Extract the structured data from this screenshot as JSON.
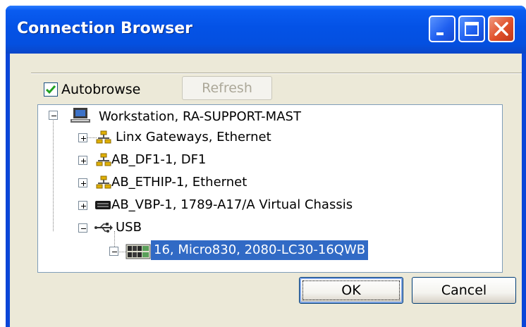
{
  "window": {
    "title": "Connection Browser",
    "accent": "#0a46d8",
    "controls": {
      "minimize": "minimize-icon",
      "maximize": "maximize-icon",
      "close": "close-icon"
    }
  },
  "options": {
    "autobrowse_label": "Autobrowse",
    "autobrowse_checked": true,
    "refresh_label": "Refresh",
    "refresh_enabled": false
  },
  "tree": {
    "root": {
      "label": "Workstation, RA-SUPPORT-MAST",
      "icon": "computer-icon",
      "expanded": true
    },
    "children": [
      {
        "label": " Linx Gateways, Ethernet",
        "icon": "network-icon",
        "expanded": false
      },
      {
        "label": "AB_DF1-1, DF1",
        "icon": "network-icon",
        "expanded": false
      },
      {
        "label": "AB_ETHIP-1, Ethernet",
        "icon": "network-icon",
        "expanded": false
      },
      {
        "label": "AB_VBP-1, 1789-A17/A Virtual Chassis",
        "icon": "chassis-icon",
        "expanded": false
      },
      {
        "label": "USB",
        "icon": "usb-icon",
        "expanded": true
      }
    ],
    "usb_children": [
      {
        "label": "16, Micro830, 2080-LC30-16QWB",
        "icon": "controller-icon",
        "selected": true
      }
    ],
    "selection_color": "#316ac5"
  },
  "buttons": {
    "ok_label": "OK",
    "cancel_label": "Cancel"
  }
}
